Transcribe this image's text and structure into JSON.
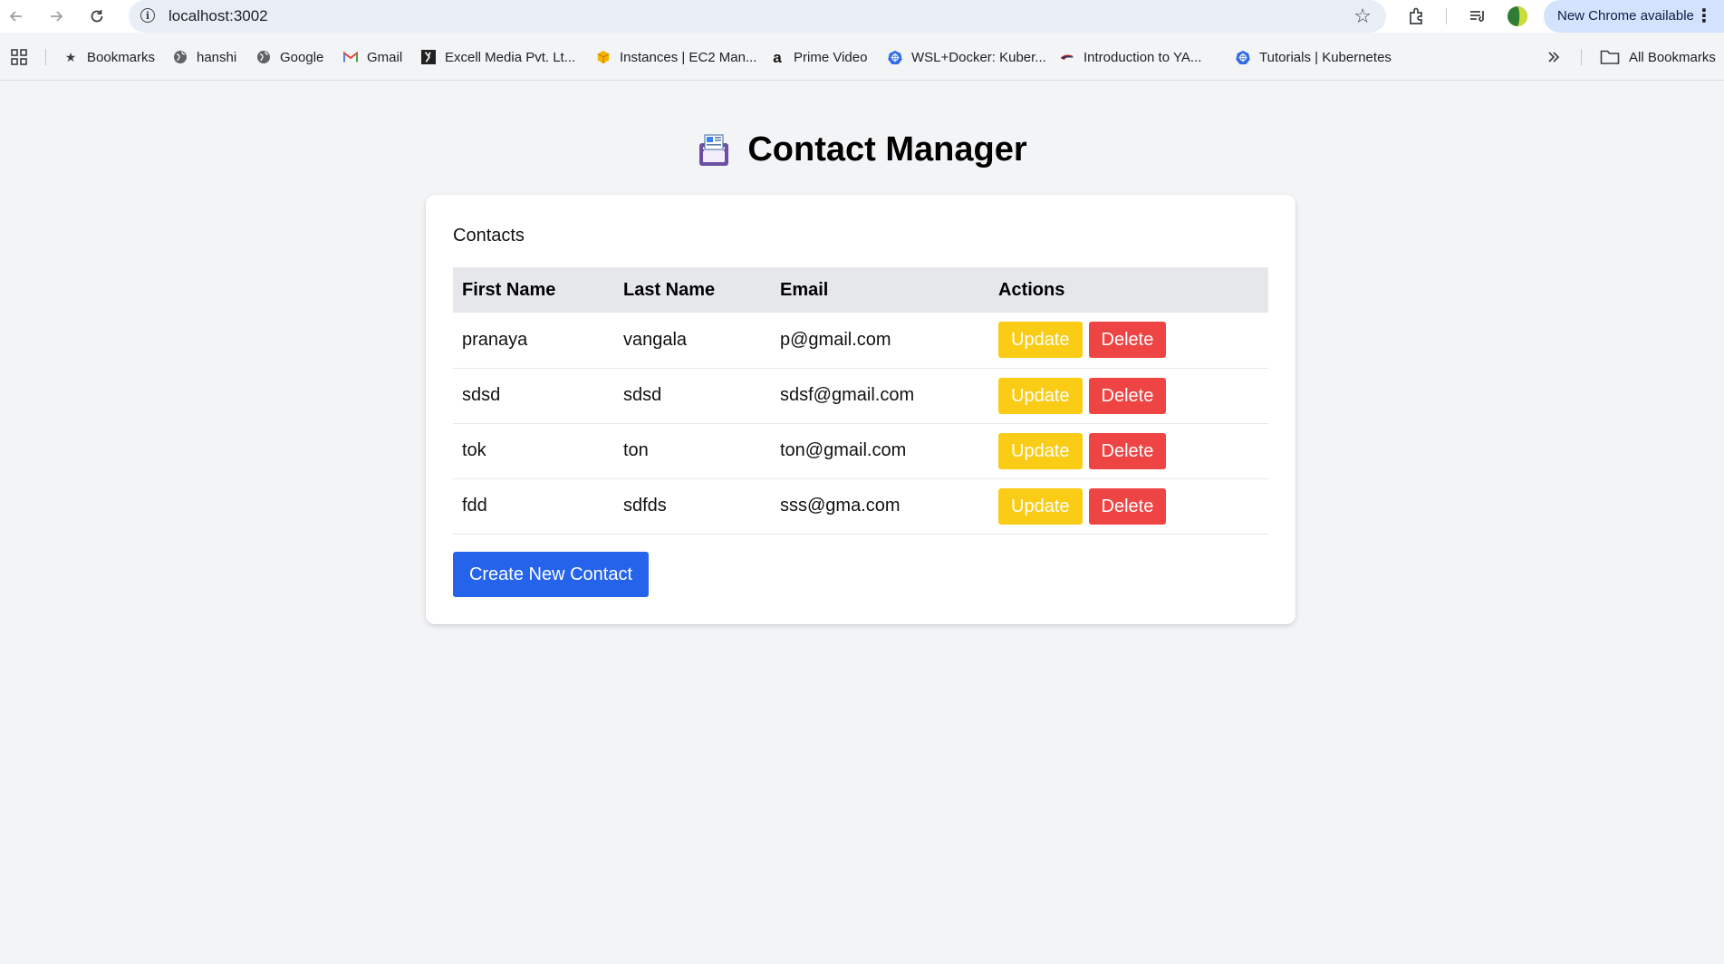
{
  "browser": {
    "url": "localhost:3002",
    "new_chrome_label": "New Chrome available",
    "bookmarks": [
      {
        "label": "Bookmarks",
        "icon": "star-icon"
      },
      {
        "label": "hanshi",
        "icon": "globe-icon"
      },
      {
        "label": "Google",
        "icon": "globe-icon"
      },
      {
        "label": "Gmail",
        "icon": "gmail-icon"
      },
      {
        "label": "Excell Media Pvt. Lt...",
        "icon": "excell-icon"
      },
      {
        "label": "Instances | EC2 Man...",
        "icon": "aws-icon"
      },
      {
        "label": "Prime Video",
        "icon": "amazon-icon"
      },
      {
        "label": "WSL+Docker: Kuber...",
        "icon": "kubernetes-icon"
      },
      {
        "label": "Introduction to YA...",
        "icon": "swoosh-icon"
      },
      {
        "label": "Tutorials | Kubernetes",
        "icon": "kubernetes-icon"
      }
    ],
    "all_bookmarks_label": "All Bookmarks"
  },
  "app": {
    "title": "Contact Manager",
    "contacts_label": "Contacts",
    "columns": [
      "First Name",
      "Last Name",
      "Email",
      "Actions"
    ],
    "update_label": "Update",
    "delete_label": "Delete",
    "create_label": "Create New Contact",
    "contacts": [
      {
        "first": "pranaya",
        "last": "vangala",
        "email": "p@gmail.com"
      },
      {
        "first": "sdsd",
        "last": "sdsd",
        "email": "sdsf@gmail.com"
      },
      {
        "first": "tok",
        "last": "ton",
        "email": "ton@gmail.com"
      },
      {
        "first": "fdd",
        "last": "sdfds",
        "email": "sss@gma.com"
      }
    ]
  },
  "colors": {
    "update": "#facc15",
    "delete": "#ef4444",
    "create": "#2563eb",
    "header_row": "#e5e7eb",
    "page_bg": "#f3f4f6"
  }
}
